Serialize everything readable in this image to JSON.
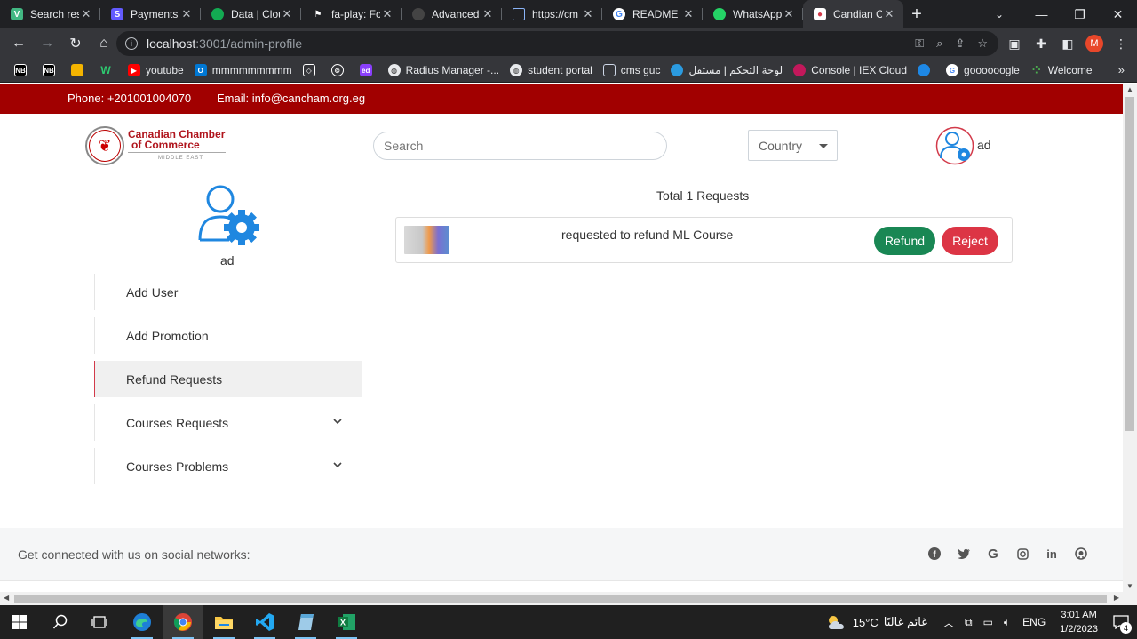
{
  "browser": {
    "tabs": [
      {
        "title": "Search res",
        "icon": "vue-icon",
        "color": "#42b883",
        "active": false
      },
      {
        "title": "Payments",
        "icon": "stripe-icon",
        "color": "#635bff",
        "active": false
      },
      {
        "title": "Data | Clou",
        "icon": "mongodb-icon",
        "color": "#13aa52",
        "active": false
      },
      {
        "title": "fa-play: Fo",
        "icon": "flag-icon",
        "color": "#ffffff",
        "active": false
      },
      {
        "title": "Advanced",
        "icon": "github-icon",
        "color": "#333333",
        "active": false
      },
      {
        "title": "https://cm",
        "icon": "document-icon",
        "color": "#8ab4f8",
        "active": false
      },
      {
        "title": "README F",
        "icon": "google-icon",
        "color": "#ffffff",
        "active": false
      },
      {
        "title": "WhatsApp",
        "icon": "whatsapp-icon",
        "color": "#25d366",
        "active": false
      },
      {
        "title": "Candian C",
        "icon": "cancham-icon",
        "color": "#d23a4a",
        "active": true
      }
    ],
    "url_host": "localhost",
    "url_path": ":3001/admin-profile",
    "bookmarks": [
      {
        "label": "",
        "icon": "nb-icon"
      },
      {
        "label": "",
        "icon": "nb2-icon"
      },
      {
        "label": "",
        "icon": "cloud-icon"
      },
      {
        "label": "",
        "icon": "w-icon"
      },
      {
        "label": "youtube",
        "icon": "youtube-icon"
      },
      {
        "label": "mmmmmmmmm",
        "icon": "office-icon"
      },
      {
        "label": "",
        "icon": "codepen-icon"
      },
      {
        "label": "",
        "icon": "chatgpt-icon"
      },
      {
        "label": "",
        "icon": "ed-icon"
      },
      {
        "label": "Radius Manager -...",
        "icon": "globe-icon"
      },
      {
        "label": "student portal",
        "icon": "globe-icon"
      },
      {
        "label": "cms guc",
        "icon": "document-icon"
      },
      {
        "label": "لوحة التحكم | مستقل",
        "icon": "mostaql-icon"
      },
      {
        "label": "Console | IEX Cloud",
        "icon": "iex-icon"
      },
      {
        "label": "",
        "icon": "circle-icon"
      },
      {
        "label": "goooooogle",
        "icon": "google-icon"
      },
      {
        "label": "Welcome",
        "icon": "dots-icon"
      }
    ]
  },
  "page": {
    "topbar": {
      "phone": "Phone: +201001004070",
      "email": "Email: info@cancham.org.eg"
    },
    "logo": {
      "line1": "Canadian Chamber",
      "line2": "of Commerce",
      "line3": "MIDDLE EAST"
    },
    "search_placeholder": "Search",
    "country_label": "Country",
    "user_name": "ad",
    "sidebar": {
      "items": [
        {
          "label": "Add User",
          "active": false,
          "has_chevron": false
        },
        {
          "label": "Add Promotion",
          "active": false,
          "has_chevron": false
        },
        {
          "label": "Refund Requests",
          "active": true,
          "has_chevron": false
        },
        {
          "label": "Courses Requests",
          "active": false,
          "has_chevron": true
        },
        {
          "label": "Courses Problems",
          "active": false,
          "has_chevron": true
        }
      ]
    },
    "main": {
      "total_label": "Total 1 Requests",
      "requests": [
        {
          "text": "requested to refund ML Course",
          "refund_label": "Refund",
          "reject_label": "Reject"
        }
      ]
    },
    "footer": {
      "connect_text": "Get connected with us on social networks:",
      "socials": [
        "facebook-icon",
        "twitter-icon",
        "google-icon",
        "instagram-icon",
        "linkedin-icon",
        "github-icon"
      ]
    }
  },
  "taskbar": {
    "weather_temp": "15°C",
    "weather_desc": "غائم غالبًا",
    "language": "ENG",
    "time": "3:01 AM",
    "date": "1/2/2023",
    "notifications": "4"
  },
  "colors": {
    "brand_red": "#a10000",
    "refund_green": "#198754",
    "reject_red": "#dc3545",
    "active_border": "#d23a4a",
    "avatar_blue": "#1f87e0"
  }
}
